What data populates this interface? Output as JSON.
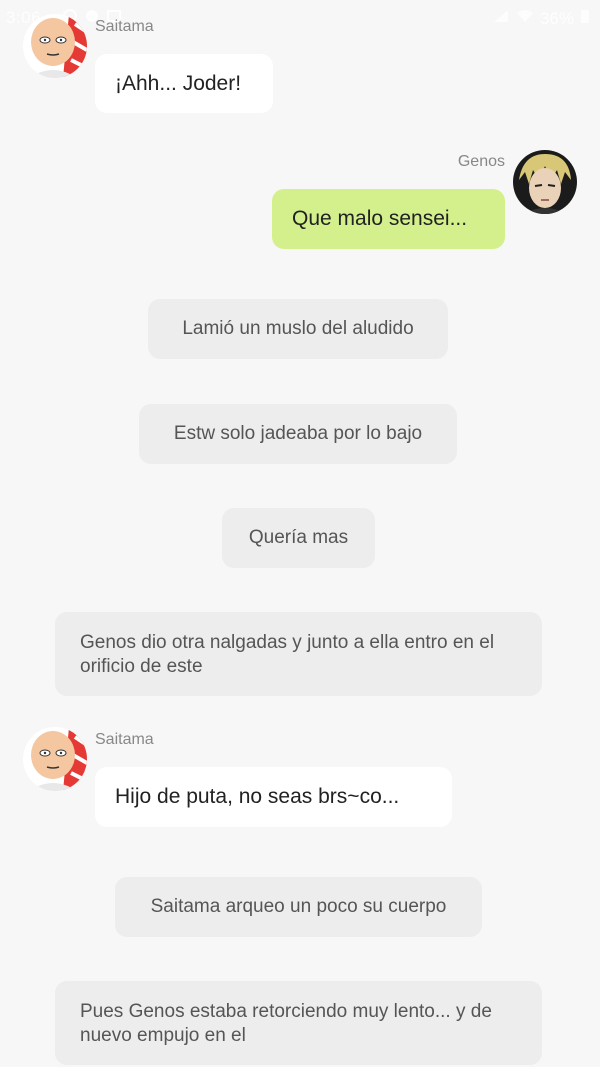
{
  "status_bar": {
    "time": "3:06",
    "battery": "36%"
  },
  "messages": [
    {
      "type": "incoming",
      "sender": "Saitama",
      "text": "¡Ahh... Joder!",
      "avatar_icon": "saitama-avatar-icon"
    },
    {
      "type": "outgoing",
      "sender": "Genos",
      "text": "Que malo sensei...",
      "avatar_icon": "genos-avatar-icon"
    },
    {
      "type": "narration",
      "text": "Lamió un muslo del aludido"
    },
    {
      "type": "narration",
      "text": "Estw solo jadeaba por lo bajo"
    },
    {
      "type": "narration",
      "text": "Quería mas"
    },
    {
      "type": "narration",
      "text": "Genos dio otra nalgadas y junto a ella entro en el orificio de este"
    },
    {
      "type": "incoming",
      "sender": "Saitama",
      "text": "Hijo de puta, no seas brs~co...",
      "avatar_icon": "saitama-avatar-icon"
    },
    {
      "type": "narration",
      "text": "Saitama arqueo un poco su cuerpo"
    },
    {
      "type": "narration",
      "text": "Pues Genos estaba retorciendo muy lento... y de nuevo empujo en el"
    }
  ],
  "colors": {
    "background": "#f7f7f7",
    "outgoing_bubble": "#d4f08c",
    "incoming_bubble": "#ffffff",
    "narration_bubble": "#ededed"
  }
}
